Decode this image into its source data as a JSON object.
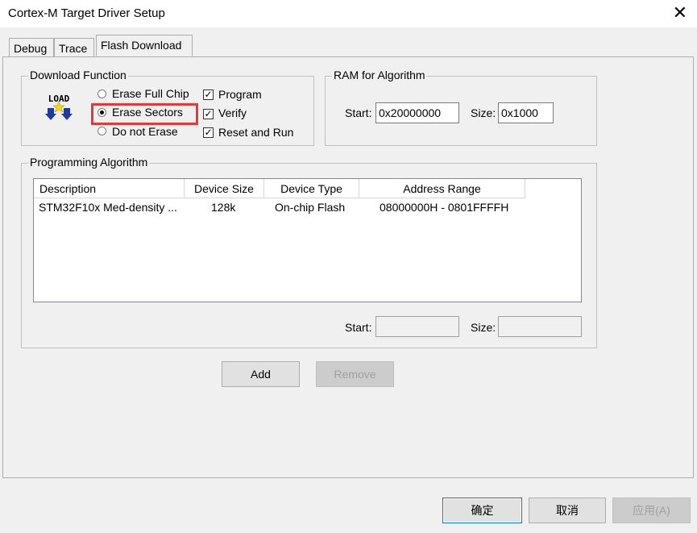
{
  "window": {
    "title": "Cortex-M Target Driver Setup",
    "close_label": "✕"
  },
  "tabs": [
    {
      "label": "Debug"
    },
    {
      "label": "Trace"
    },
    {
      "label": "Flash Download",
      "active": true
    }
  ],
  "download_function": {
    "legend": "Download Function",
    "icon_text": "LOAD",
    "radios": [
      {
        "label": "Erase Full Chip",
        "selected": false
      },
      {
        "label": "Erase Sectors",
        "selected": true
      },
      {
        "label": "Do not Erase",
        "selected": false
      }
    ],
    "checks": [
      {
        "label": "Program",
        "checked": true
      },
      {
        "label": "Verify",
        "checked": true
      },
      {
        "label": "Reset and Run",
        "checked": true
      }
    ]
  },
  "ram": {
    "legend": "RAM for Algorithm",
    "start_label": "Start:",
    "start_value": "0x20000000",
    "size_label": "Size:",
    "size_value": "0x1000"
  },
  "programming_algorithm": {
    "legend": "Programming Algorithm",
    "columns": [
      "Description",
      "Device Size",
      "Device Type",
      "Address Range"
    ],
    "rows": [
      {
        "description": "STM32F10x Med-density ...",
        "size": "128k",
        "type": "On-chip Flash",
        "range": "08000000H - 0801FFFFH"
      }
    ],
    "start_label": "Start:",
    "start_value": "",
    "size_label": "Size:",
    "size_value": ""
  },
  "buttons": {
    "add": "Add",
    "remove": "Remove",
    "ok": "确定",
    "cancel": "取消",
    "apply": "应用(A)"
  },
  "colors": {
    "highlight": "#e53935",
    "accent": "#0078d7"
  }
}
